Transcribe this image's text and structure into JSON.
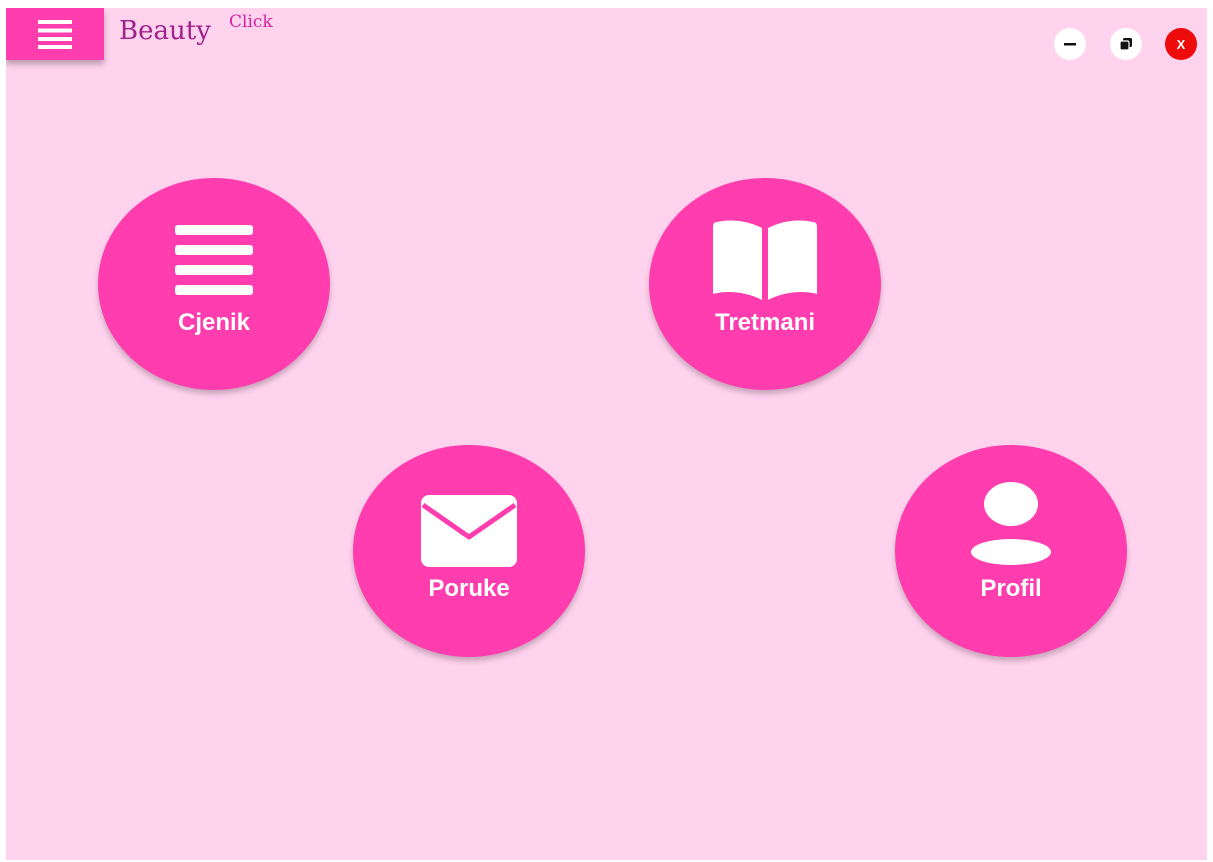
{
  "brand": {
    "name_main": "Beauty",
    "name_sup": "Click"
  },
  "header": {
    "menu_icon": "hamburger-menu-icon",
    "window_controls": {
      "minimize_icon": "minimize-icon",
      "restore_icon": "restore-icon",
      "close_label": "X"
    }
  },
  "tiles": [
    {
      "label": "Cjenik",
      "icon": "list-icon"
    },
    {
      "label": "Tretmani",
      "icon": "open-book-icon"
    },
    {
      "label": "Poruke",
      "icon": "envelope-icon"
    },
    {
      "label": "Profil",
      "icon": "user-icon"
    }
  ],
  "colors": {
    "background": "#ffd3ee",
    "accent": "#ff3dae",
    "brand_text": "#a0228a",
    "close_button": "#ee0b0b"
  }
}
